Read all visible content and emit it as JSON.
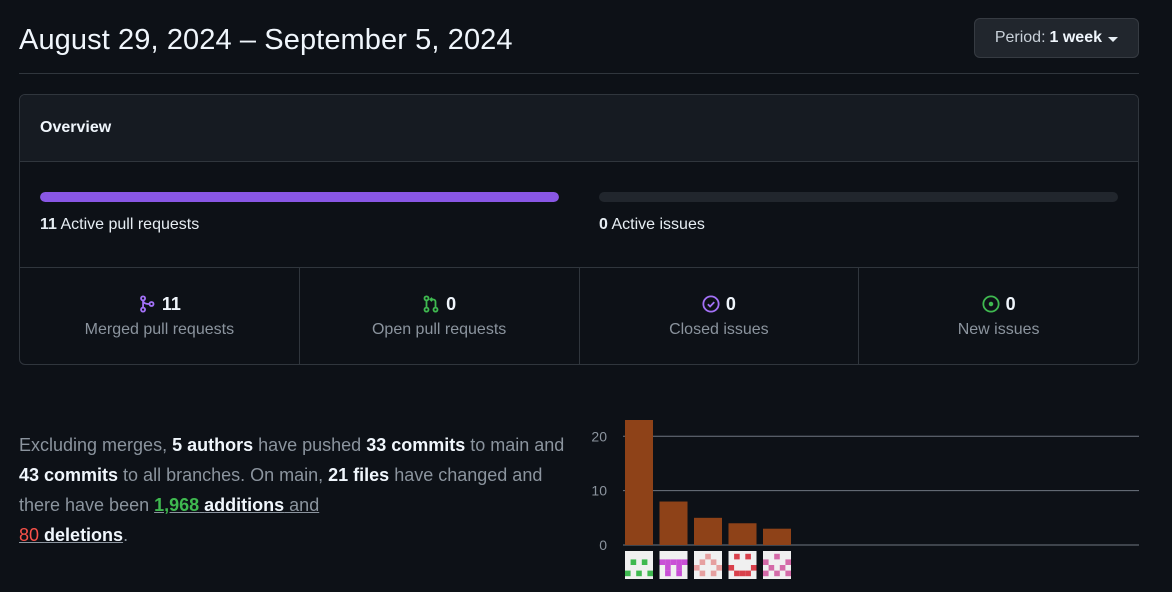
{
  "header": {
    "date_range": "August 29, 2024 – September 5, 2024",
    "period_prefix": "Period:",
    "period_value": "1 week"
  },
  "overview": {
    "title": "Overview",
    "active_pull_requests": {
      "count": "11",
      "label": "Active pull requests",
      "progress": 1.0
    },
    "active_issues": {
      "count": "0",
      "label": "Active issues",
      "progress": 0.0
    },
    "stats": [
      {
        "icon": "git-merge-icon",
        "count": "11",
        "label": "Merged pull requests",
        "color": "#a371f7"
      },
      {
        "icon": "git-pull-request-icon",
        "count": "0",
        "label": "Open pull requests",
        "color": "#3fb950"
      },
      {
        "icon": "issue-closed-icon",
        "count": "0",
        "label": "Closed issues",
        "color": "#a371f7"
      },
      {
        "icon": "issue-opened-icon",
        "count": "0",
        "label": "New issues",
        "color": "#3fb950"
      }
    ]
  },
  "summary": {
    "t1": "Excluding merges, ",
    "authors": "5 authors",
    "t2": " have pushed ",
    "commits_main": "33 commits",
    "t3": " to main and ",
    "commits_all": "43 commits",
    "t4": " to all branches. On main, ",
    "files": "21 files",
    "t5": " have changed and there have been ",
    "additions_num": "1,968",
    "additions_word": "additions",
    "t6": " and ",
    "deletions_num": "80",
    "deletions_word": "deletions",
    "t7": "."
  },
  "colors": {
    "bar": "#8e4218",
    "progress": "#8957e5",
    "green": "#3fb950",
    "red": "#f85149",
    "purple": "#a371f7"
  },
  "chart_data": {
    "type": "bar",
    "categories": [
      "author-1",
      "author-2",
      "author-3",
      "author-4",
      "author-5"
    ],
    "values": [
      23,
      8,
      5,
      4,
      3
    ],
    "ylim": [
      0,
      23
    ],
    "yticks": [
      "0",
      "10",
      "20"
    ],
    "grid": true,
    "bar_color": "#8e4218",
    "avatar_colors": [
      "#3fb950",
      "#c94fd6",
      "#e6a0a0",
      "#d9404b",
      "#d46aa8"
    ]
  }
}
